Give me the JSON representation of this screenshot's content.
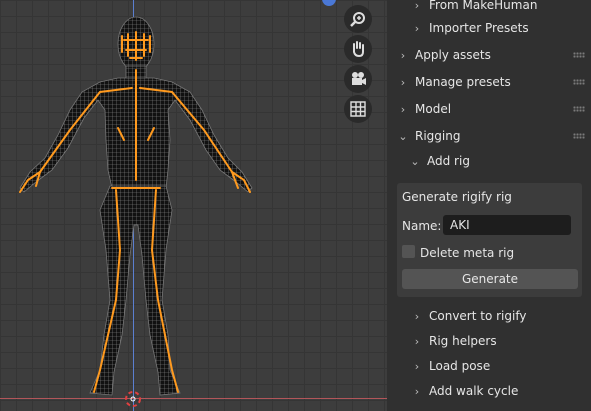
{
  "toolbar": {
    "zoom_icon": "zoom-icon",
    "pan_icon": "hand-icon",
    "camera_icon": "camera-icon",
    "grid_icon": "grid-icon"
  },
  "panel": {
    "items": [
      {
        "label": "From MakeHuman",
        "expanded": false
      },
      {
        "label": "Importer Presets",
        "expanded": false
      },
      {
        "label": "Apply assets",
        "expanded": false
      },
      {
        "label": "Manage presets",
        "expanded": false
      },
      {
        "label": "Model",
        "expanded": false
      },
      {
        "label": "Rigging",
        "expanded": true
      },
      {
        "label": "Add rig",
        "expanded": true
      }
    ],
    "add_rig": {
      "title": "Generate rigify rig",
      "name_label": "Name:",
      "name_value": "AKI",
      "delete_meta_label": "Delete meta rig",
      "delete_meta_checked": false,
      "generate_label": "Generate"
    },
    "sub_items": [
      {
        "label": "Convert to rigify"
      },
      {
        "label": "Rig helpers"
      },
      {
        "label": "Load pose"
      },
      {
        "label": "Add walk cycle"
      }
    ]
  },
  "colors": {
    "rig_orange": "#ff9a1f",
    "mesh_lines": "#9a9a9a",
    "axis_blue": "#5b7fd0",
    "axis_red": "#b3565a"
  }
}
